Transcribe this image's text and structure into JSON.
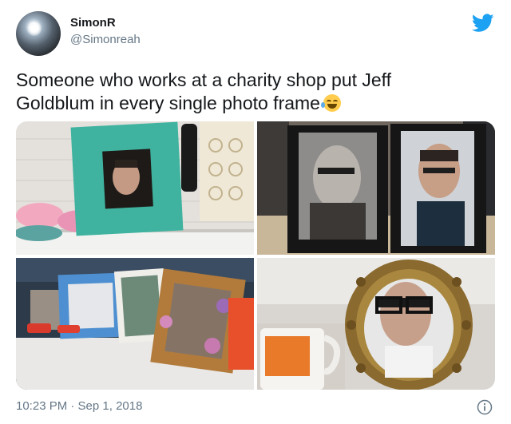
{
  "user": {
    "display_name": "SimonR",
    "handle": "@Simonreah"
  },
  "tweet": {
    "text_line1": "Someone who works at a charity shop put Jeff",
    "text_line2": "Goldblum in every single photo frame",
    "emoji": "face-with-tears-of-joy"
  },
  "media": {
    "photos": [
      {
        "id": "photo-1",
        "subject": "teal-photo-frame-on-shelf"
      },
      {
        "id": "photo-2",
        "subject": "two-standing-photo-frames"
      },
      {
        "id": "photo-3",
        "subject": "assorted-frames-on-shelf"
      },
      {
        "id": "photo-4",
        "subject": "ornate-gold-frame-with-mug"
      }
    ]
  },
  "footer": {
    "timestamp": "10:23 PM · Sep 1, 2018"
  },
  "icons": {
    "brand": "twitter-bird-icon",
    "info": "info-icon"
  },
  "colors": {
    "brand_blue": "#1da1f2",
    "text_primary": "#14171a",
    "text_secondary": "#657786"
  }
}
